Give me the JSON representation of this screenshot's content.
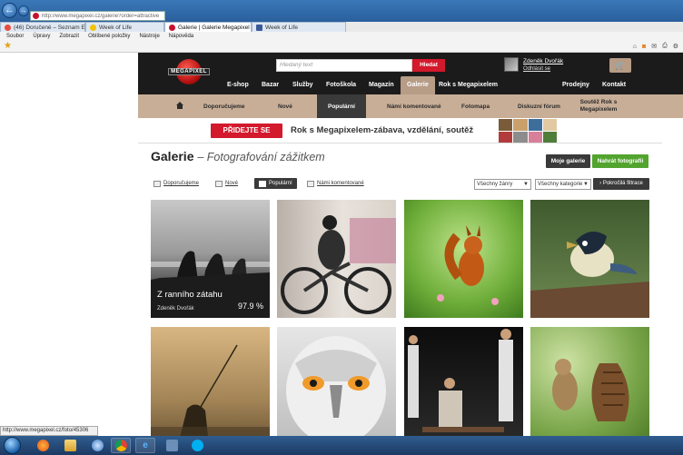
{
  "browser": {
    "address": "http://www.megapixel.cz/galerie?order=attractive",
    "tabs": [
      {
        "label": "(46) Doručené – Seznam Email",
        "active": false
      },
      {
        "label": "Week of Life",
        "active": false
      },
      {
        "label": "Galerie | Galerie Megapixel",
        "active": true
      },
      {
        "label": "Week of Life",
        "active": false
      }
    ],
    "menu": [
      "Soubor",
      "Úpravy",
      "Zobrazit",
      "Oblíbené položky",
      "Nástroje",
      "Nápověda"
    ],
    "status": "http://www.megapixel.cz/foto/45306"
  },
  "site": {
    "logo_text": "MEGAPIXEL",
    "search": {
      "placeholder": "Hledaný text",
      "button": "Hledat"
    },
    "user": {
      "name": "Zdeněk Dvořák",
      "logout": "Odhlásit se"
    },
    "cart_icon": "cart-icon",
    "main_nav": [
      {
        "label": "E-shop"
      },
      {
        "label": "Bazar"
      },
      {
        "label": "Služby"
      },
      {
        "label": "Fotoškola"
      },
      {
        "label": "Magazín"
      },
      {
        "label": "Galerie",
        "active": true
      },
      {
        "label": "Rok s Megapixelem"
      },
      {
        "label": "Prodejny"
      },
      {
        "label": "Kontakt"
      }
    ],
    "sub_nav": [
      {
        "label": "Doporučujeme"
      },
      {
        "label": "Nové"
      },
      {
        "label": "Populární",
        "active": true
      },
      {
        "label": "Námi komentované"
      },
      {
        "label": "Fotomapa"
      },
      {
        "label": "Diskuzní fórum"
      },
      {
        "label": "Soutěž Rok s Megapixelem"
      }
    ],
    "banner": {
      "button": "PŘIDEJTE SE",
      "text": "Rok s Megapixelem-zábava, vzdělání, soutěž"
    }
  },
  "gallery": {
    "title": "Galerie",
    "subtitle": "– Fotografování zážitkem",
    "my_gallery": "Moje galerie",
    "upload": "Nahrát fotografii",
    "filters": [
      {
        "label": "Doporučujeme"
      },
      {
        "label": "Nové"
      },
      {
        "label": "Populární",
        "active": true
      },
      {
        "label": "Námi komentované"
      }
    ],
    "genre_select": "Všechny žánry",
    "category_select": "Všechny kategorie",
    "advanced_filter": "Pokročilá filtrace",
    "photos": [
      {
        "caption": "Z ranního zátahu",
        "author": "Zdeněk Dvořák",
        "score": "97.9 %"
      }
    ]
  },
  "colors": {
    "brand_red": "#d3192c",
    "nav_tan": "#c8ae97",
    "header_dark": "#1b1b1b",
    "upload_green": "#52a42f"
  }
}
